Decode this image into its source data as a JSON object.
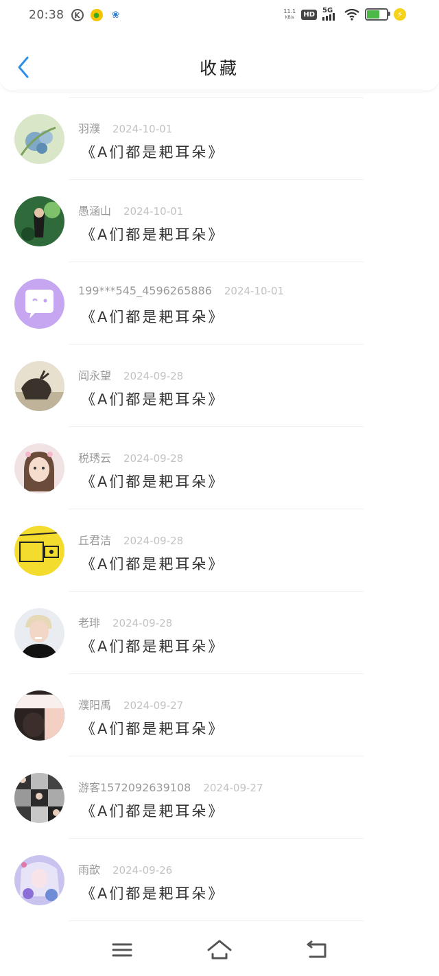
{
  "status_bar": {
    "time": "20:38",
    "netspeed_value": "11.1",
    "netspeed_unit": "KB/s",
    "hd_badge": "HD",
    "signal_label": "5G",
    "icons": [
      "k-icon",
      "app-icon",
      "paw-icon",
      "hd-icon",
      "signal-icon",
      "wifi-icon",
      "battery-icon",
      "charging-icon"
    ]
  },
  "header": {
    "title": "收藏",
    "back_icon": "chevron-left-icon"
  },
  "colors": {
    "accent": "#2f8fe8",
    "meta_text": "#999999",
    "date_text": "#c2c2c2"
  },
  "items": [
    {
      "user": "羽濮",
      "date": "2024-10-01",
      "title": "《A们都是耙耳朵》"
    },
    {
      "user": "愚涵山",
      "date": "2024-10-01",
      "title": "《A们都是耙耳朵》"
    },
    {
      "user": "199***545_4596265886",
      "date": "2024-10-01",
      "title": "《A们都是耙耳朵》"
    },
    {
      "user": "阎永望",
      "date": "2024-09-28",
      "title": "《A们都是耙耳朵》"
    },
    {
      "user": "税琇云",
      "date": "2024-09-28",
      "title": "《A们都是耙耳朵》"
    },
    {
      "user": "丘君洁",
      "date": "2024-09-28",
      "title": "《A们都是耙耳朵》"
    },
    {
      "user": "老琲",
      "date": "2024-09-28",
      "title": "《A们都是耙耳朵》"
    },
    {
      "user": "濮阳禹",
      "date": "2024-09-27",
      "title": "《A们都是耙耳朵》"
    },
    {
      "user": "游客1572092639108",
      "date": "2024-09-27",
      "title": "《A们都是耙耳朵》"
    },
    {
      "user": "雨歆",
      "date": "2024-09-26",
      "title": "《A们都是耙耳朵》"
    }
  ],
  "navbar": {
    "icons": [
      "menu-icon",
      "home-icon",
      "back-icon"
    ]
  }
}
